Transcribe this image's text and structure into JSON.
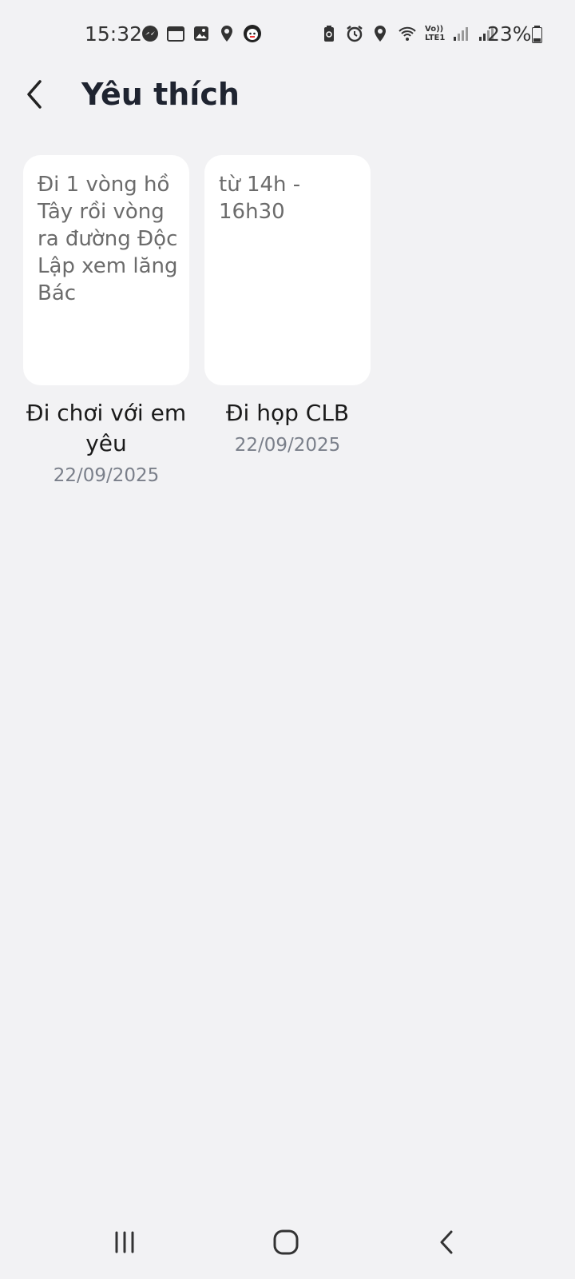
{
  "status_bar": {
    "time": "15:32",
    "battery": "23%",
    "lte_label_top": "Vo))",
    "lte_label_bottom": "LTE1",
    "left_icons": [
      "messenger-icon",
      "calendar-icon",
      "gallery-icon",
      "location-icon",
      "app-avatar-icon"
    ],
    "right_icons": [
      "battery-saver-icon",
      "alarm-icon",
      "location-icon",
      "wifi-icon",
      "signal-icon-1",
      "signal-icon-2"
    ]
  },
  "header": {
    "title": "Yêu thích"
  },
  "notes": [
    {
      "preview": "Đi 1 vòng hồ Tây rồi vòng ra đường Độc Lập xem lăng Bác",
      "title": "Đi chơi với em yêu",
      "date": "22/09/2025"
    },
    {
      "preview": "từ 14h - 16h30",
      "title": "Đi họp CLB",
      "date": "22/09/2025"
    }
  ],
  "colors": {
    "background": "#f2f2f4",
    "card": "#ffffff",
    "title_text": "#1f2430",
    "date_text": "#7a7f8a"
  }
}
